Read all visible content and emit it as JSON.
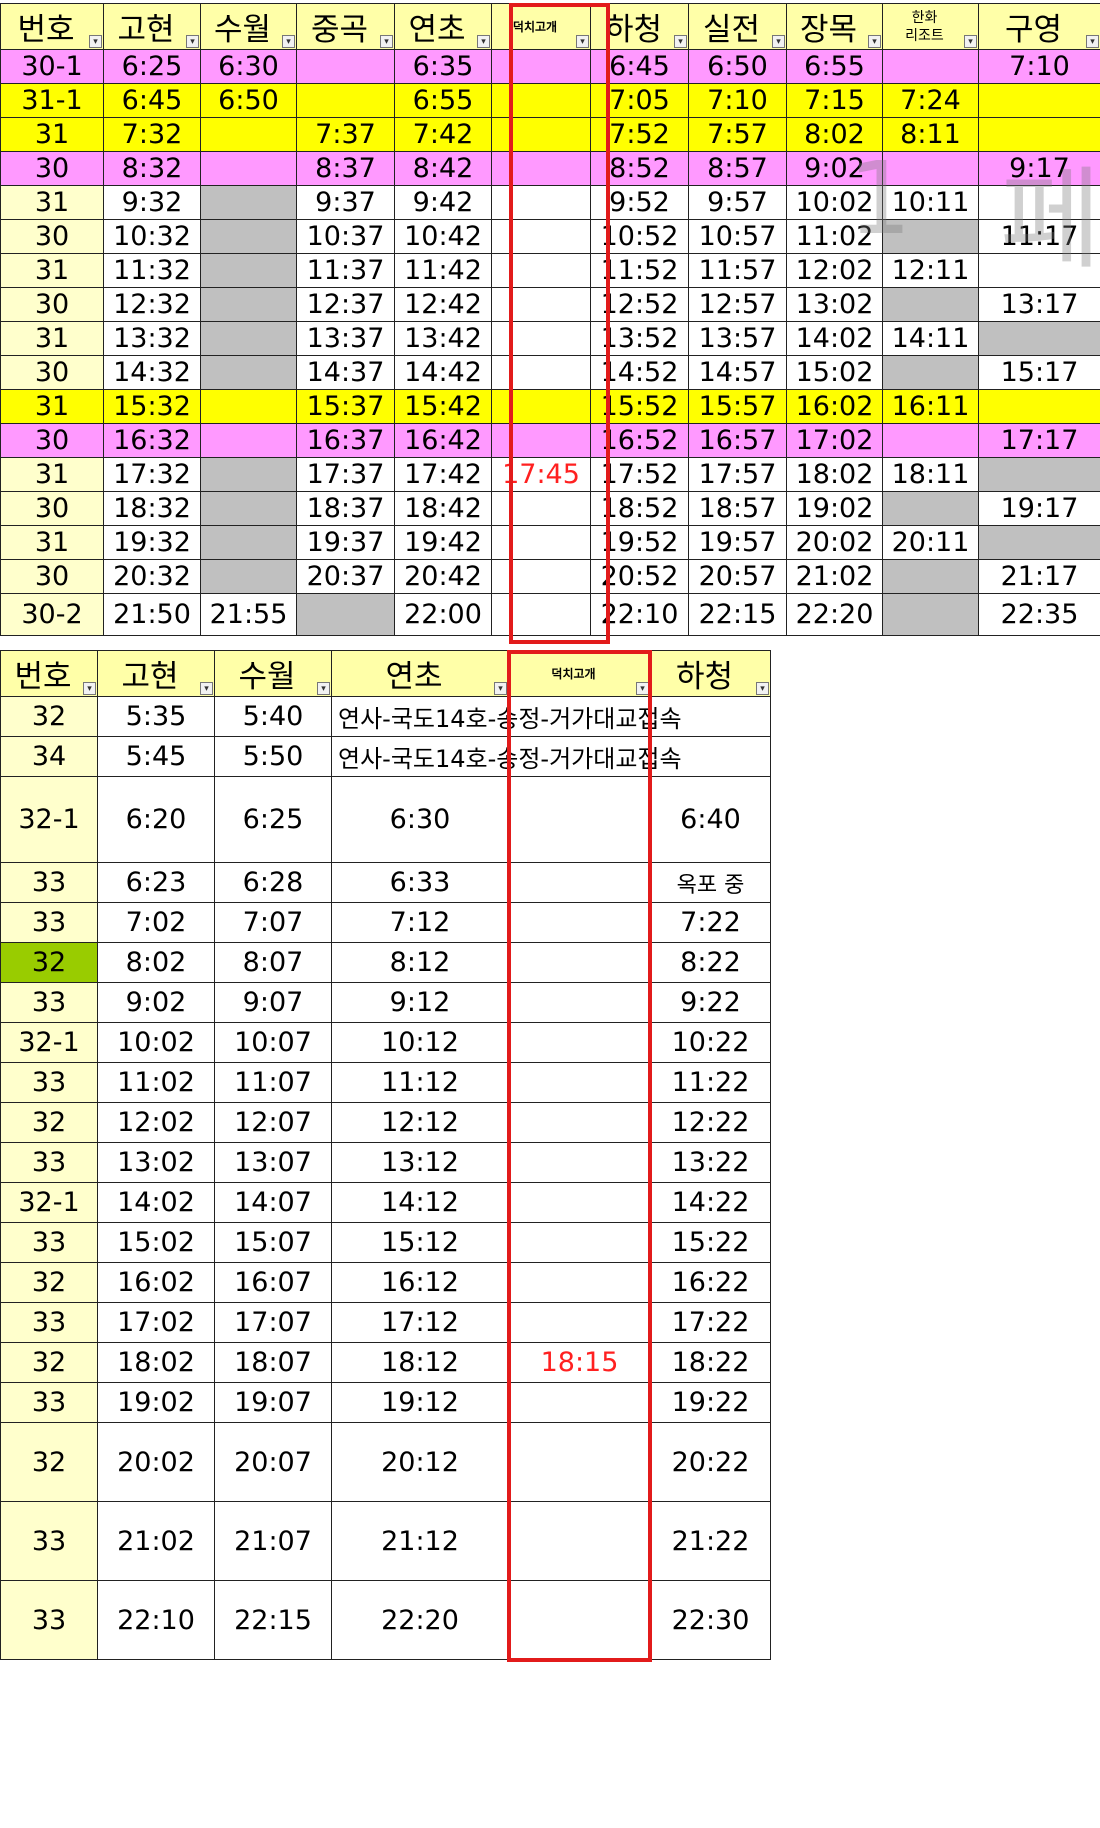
{
  "table1": {
    "headers": [
      "번호",
      "고현",
      "수월",
      "중곡",
      "연초",
      "덕치고개",
      "하청",
      "실전",
      "장목",
      "한화\n리조트",
      "구영"
    ],
    "rows": [
      {
        "style": "pink",
        "cells": [
          "30-1",
          "6:25",
          "6:30",
          "",
          "6:35",
          "",
          "6:45",
          "6:50",
          "6:55",
          "",
          "7:10"
        ]
      },
      {
        "style": "yellow",
        "cells": [
          "31-1",
          "6:45",
          "6:50",
          "",
          "6:55",
          "",
          "7:05",
          "7:10",
          "7:15",
          "7:24",
          ""
        ]
      },
      {
        "style": "yellow",
        "cells": [
          "31",
          "7:32",
          "",
          "7:37",
          "7:42",
          "",
          "7:52",
          "7:57",
          "8:02",
          "8:11",
          ""
        ]
      },
      {
        "style": "pink",
        "cells": [
          "30",
          "8:32",
          "",
          "8:37",
          "8:42",
          "",
          "8:52",
          "8:57",
          "9:02",
          "",
          "9:17"
        ]
      },
      {
        "style": "plain",
        "cells": [
          "31",
          "9:32",
          "",
          "9:37",
          "9:42",
          "",
          "9:52",
          "9:57",
          "10:02",
          "10:11",
          ""
        ],
        "gray": [
          2
        ]
      },
      {
        "style": "plain",
        "cells": [
          "30",
          "10:32",
          "",
          "10:37",
          "10:42",
          "",
          "10:52",
          "10:57",
          "11:02",
          "",
          "11:17"
        ],
        "gray": [
          2,
          9
        ]
      },
      {
        "style": "plain",
        "cells": [
          "31",
          "11:32",
          "",
          "11:37",
          "11:42",
          "",
          "11:52",
          "11:57",
          "12:02",
          "12:11",
          ""
        ],
        "gray": [
          2
        ]
      },
      {
        "style": "plain",
        "cells": [
          "30",
          "12:32",
          "",
          "12:37",
          "12:42",
          "",
          "12:52",
          "12:57",
          "13:02",
          "",
          "13:17"
        ],
        "gray": [
          2,
          9
        ]
      },
      {
        "style": "plain",
        "cells": [
          "31",
          "13:32",
          "",
          "13:37",
          "13:42",
          "",
          "13:52",
          "13:57",
          "14:02",
          "14:11",
          ""
        ],
        "gray": [
          2,
          10
        ]
      },
      {
        "style": "plain",
        "cells": [
          "30",
          "14:32",
          "",
          "14:37",
          "14:42",
          "",
          "14:52",
          "14:57",
          "15:02",
          "",
          "15:17"
        ],
        "gray": [
          2,
          9
        ]
      },
      {
        "style": "yellow",
        "cells": [
          "31",
          "15:32",
          "",
          "15:37",
          "15:42",
          "",
          "15:52",
          "15:57",
          "16:02",
          "16:11",
          ""
        ]
      },
      {
        "style": "pink",
        "cells": [
          "30",
          "16:32",
          "",
          "16:37",
          "16:42",
          "",
          "16:52",
          "16:57",
          "17:02",
          "",
          "17:17"
        ]
      },
      {
        "style": "plain",
        "cells": [
          "31",
          "17:32",
          "",
          "17:37",
          "17:42",
          "17:45",
          "17:52",
          "17:57",
          "18:02",
          "18:11",
          ""
        ],
        "gray": [
          2,
          10
        ],
        "red": [
          5
        ]
      },
      {
        "style": "plain",
        "cells": [
          "30",
          "18:32",
          "",
          "18:37",
          "18:42",
          "",
          "18:52",
          "18:57",
          "19:02",
          "",
          "19:17"
        ],
        "gray": [
          2,
          9
        ]
      },
      {
        "style": "plain",
        "cells": [
          "31",
          "19:32",
          "",
          "19:37",
          "19:42",
          "",
          "19:52",
          "19:57",
          "20:02",
          "20:11",
          ""
        ],
        "gray": [
          2,
          10
        ]
      },
      {
        "style": "plain",
        "cells": [
          "30",
          "20:32",
          "",
          "20:37",
          "20:42",
          "",
          "20:52",
          "20:57",
          "21:02",
          "",
          "21:17"
        ],
        "gray": [
          2,
          9
        ]
      },
      {
        "style": "plain",
        "cells": [
          "30-2",
          "21:50",
          "21:55",
          "",
          "22:00",
          "",
          "22:10",
          "22:15",
          "22:20",
          "",
          "22:35"
        ],
        "gray": [
          3,
          9
        ],
        "tall": true
      }
    ]
  },
  "table2": {
    "headers": [
      "번호",
      "고현",
      "수월",
      "연초",
      "덕치고개",
      "하청"
    ],
    "rows": [
      {
        "cells": [
          "32",
          "5:35",
          "5:40",
          "연사-국도14호-송정-거가대교접속",
          "",
          ""
        ],
        "note": true
      },
      {
        "cells": [
          "34",
          "5:45",
          "5:50",
          "연사-국도14호-송정-거가대교접속",
          "",
          ""
        ],
        "note": true
      },
      {
        "cells": [
          "32-1",
          "6:20",
          "6:25",
          "6:30",
          "",
          "6:40"
        ],
        "h": 86
      },
      {
        "cells": [
          "33",
          "6:23",
          "6:28",
          "6:33",
          "",
          "옥포 중"
        ],
        "noteCol": 5
      },
      {
        "cells": [
          "33",
          "7:02",
          "7:07",
          "7:12",
          "",
          "7:22"
        ]
      },
      {
        "cells": [
          "32",
          "8:02",
          "8:07",
          "8:12",
          "",
          "8:22"
        ],
        "green": true
      },
      {
        "cells": [
          "33",
          "9:02",
          "9:07",
          "9:12",
          "",
          "9:22"
        ]
      },
      {
        "cells": [
          "32-1",
          "10:02",
          "10:07",
          "10:12",
          "",
          "10:22"
        ]
      },
      {
        "cells": [
          "33",
          "11:02",
          "11:07",
          "11:12",
          "",
          "11:22"
        ]
      },
      {
        "cells": [
          "32",
          "12:02",
          "12:07",
          "12:12",
          "",
          "12:22"
        ]
      },
      {
        "cells": [
          "33",
          "13:02",
          "13:07",
          "13:12",
          "",
          "13:22"
        ]
      },
      {
        "cells": [
          "32-1",
          "14:02",
          "14:07",
          "14:12",
          "",
          "14:22"
        ]
      },
      {
        "cells": [
          "33",
          "15:02",
          "15:07",
          "15:12",
          "",
          "15:22"
        ]
      },
      {
        "cells": [
          "32",
          "16:02",
          "16:07",
          "16:12",
          "",
          "16:22"
        ]
      },
      {
        "cells": [
          "33",
          "17:02",
          "17:07",
          "17:12",
          "",
          "17:22"
        ]
      },
      {
        "cells": [
          "32",
          "18:02",
          "18:07",
          "18:12",
          "18:15",
          "18:22"
        ],
        "red": [
          4
        ]
      },
      {
        "cells": [
          "33",
          "19:02",
          "19:07",
          "19:12",
          "",
          "19:22"
        ]
      },
      {
        "cells": [
          "32",
          "20:02",
          "20:07",
          "20:12",
          "",
          "20:22"
        ],
        "h": 79
      },
      {
        "cells": [
          "33",
          "21:02",
          "21:07",
          "21:12",
          "",
          "21:22"
        ],
        "h": 79
      },
      {
        "cells": [
          "33",
          "22:10",
          "22:15",
          "22:20",
          "",
          "22:30"
        ],
        "h": 79
      }
    ]
  },
  "watermark": [
    "1",
    "페"
  ],
  "colors": {
    "pink": "#ff99ff",
    "yellow": "#ffff00",
    "gray": "#c0c0c0",
    "green": "#99cc00",
    "red_text": "#ff2020",
    "highlight_frame": "#e21b1b"
  }
}
